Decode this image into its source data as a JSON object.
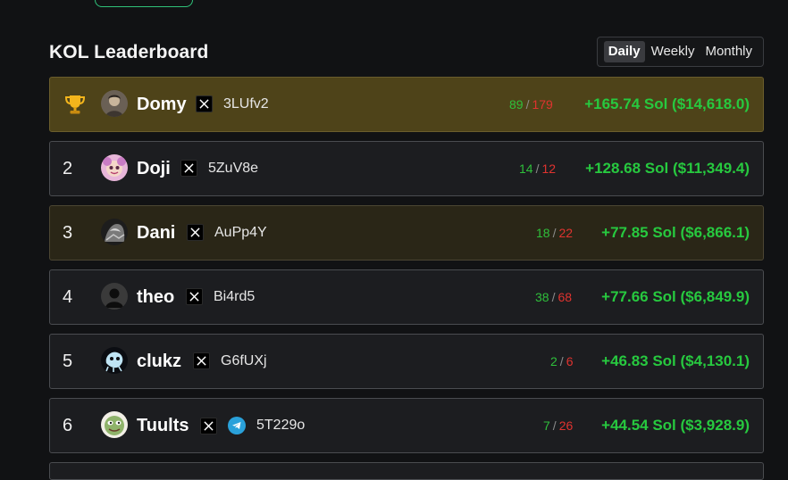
{
  "leaderboard": {
    "title": "KOL Leaderboard",
    "tabs": [
      {
        "label": "Daily",
        "active": true
      },
      {
        "label": "Weekly",
        "active": false
      },
      {
        "label": "Monthly",
        "active": false
      }
    ],
    "rows": [
      {
        "rank": "1",
        "rank_icon": "trophy-icon",
        "name": "Domy",
        "socials": [
          "x-icon"
        ],
        "wallet": "3LUfv2",
        "wins": "89",
        "losses": "179",
        "pnl": "+165.74 Sol ($14,618.0)"
      },
      {
        "rank": "2",
        "name": "Doji",
        "socials": [
          "x-icon"
        ],
        "wallet": "5ZuV8e",
        "wins": "14",
        "losses": "12",
        "pnl": "+128.68 Sol ($11,349.4)"
      },
      {
        "rank": "3",
        "name": "Dani",
        "socials": [
          "x-icon"
        ],
        "wallet": "AuPp4Y",
        "wins": "18",
        "losses": "22",
        "pnl": "+77.85 Sol ($6,866.1)"
      },
      {
        "rank": "4",
        "name": "theo",
        "socials": [
          "x-icon"
        ],
        "wallet": "Bi4rd5",
        "wins": "38",
        "losses": "68",
        "pnl": "+77.66 Sol ($6,849.9)"
      },
      {
        "rank": "5",
        "name": "clukz",
        "socials": [
          "x-icon"
        ],
        "wallet": "G6fUXj",
        "wins": "2",
        "losses": "6",
        "pnl": "+46.83 Sol ($4,130.1)"
      },
      {
        "rank": "6",
        "name": "Tuults",
        "socials": [
          "x-icon",
          "telegram-icon"
        ],
        "wallet": "5T229o",
        "wins": "7",
        "losses": "26",
        "pnl": "+44.54 Sol ($3,928.9)"
      }
    ]
  },
  "colors": {
    "background": "#111214",
    "row_bg": "#1c1d20",
    "gold_row_bg": "#4e4319",
    "bronze_row_bg": "#2a2617",
    "profit_green": "#27c93f",
    "win_green": "#2fbf3b",
    "loss_red": "#e0332f"
  }
}
